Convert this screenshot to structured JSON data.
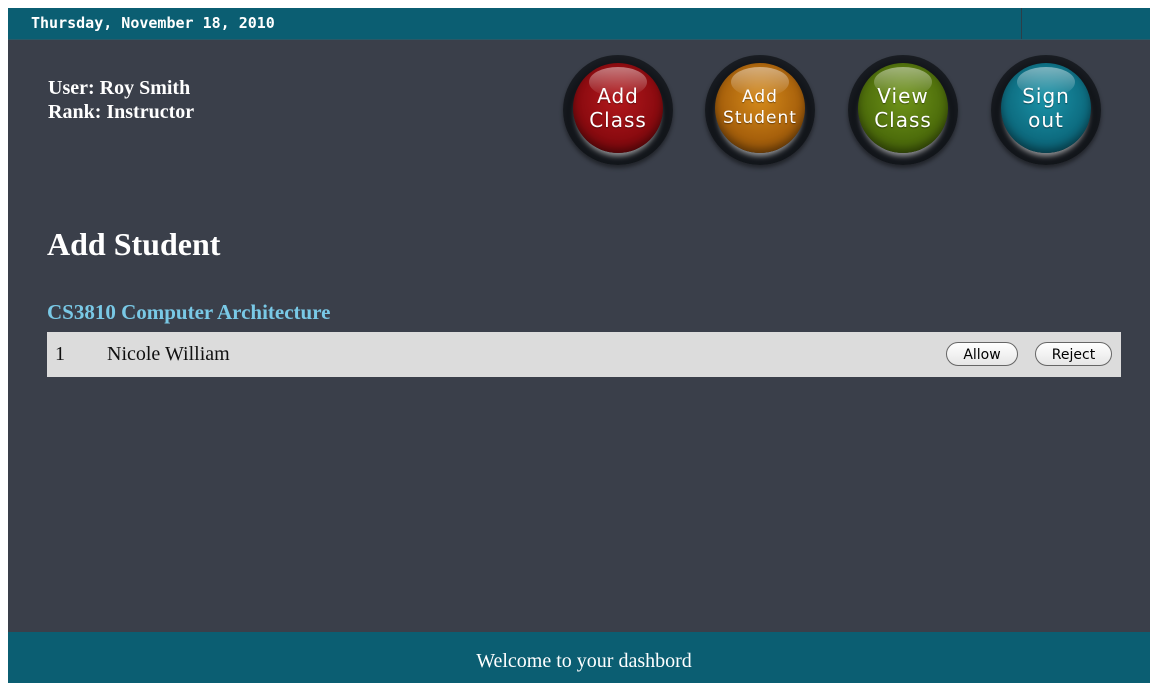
{
  "header": {
    "date": "Thursday, November 18, 2010"
  },
  "user": {
    "name_line": "User: Roy Smith",
    "rank_line": "Rank: Instructor"
  },
  "nav": {
    "add_class": [
      "Add",
      "Class"
    ],
    "add_student": [
      "Add",
      "Student"
    ],
    "view_class": [
      "View",
      "Class"
    ],
    "sign_out": [
      "Sign",
      "out"
    ],
    "colors": {
      "add_class": "#8c0b10",
      "add_student": "#a9620c",
      "view_class": "#4f6f0c",
      "sign_out": "#0e6e82"
    }
  },
  "main": {
    "title": "Add Student",
    "course": "CS3810 Computer Architecture",
    "requests": [
      {
        "number": "1",
        "name": "Nicole William",
        "allow_label": "Allow",
        "reject_label": "Reject"
      }
    ]
  },
  "footer": {
    "message": "Welcome to your dashbord"
  },
  "theme": {
    "background": "#3a3f4a",
    "bar": "#0b5e72",
    "course_color": "#79c9e6",
    "row_background": "#dcdcdc"
  }
}
